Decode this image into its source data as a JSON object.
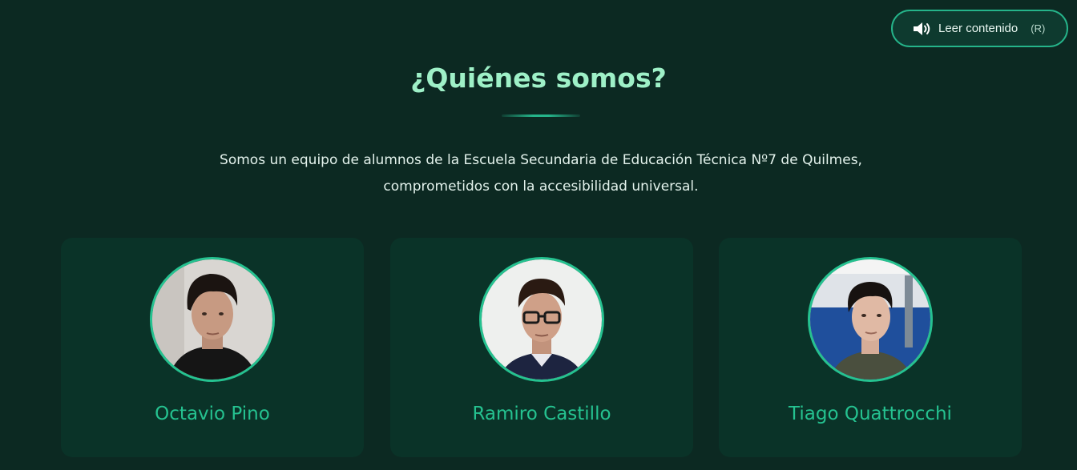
{
  "reader_button": {
    "label": "Leer contenido",
    "shortcut": "(R)",
    "icon": "speaker-icon"
  },
  "section": {
    "title": "¿Quiénes somos?",
    "intro": "Somos un equipo de alumnos de la Escuela Secundaria de Educación Técnica Nº7 de Quilmes, comprometidos con la accesibilidad universal."
  },
  "team": [
    {
      "name": "Octavio Pino"
    },
    {
      "name": "Ramiro Castillo"
    },
    {
      "name": "Tiago Quattrocchi"
    }
  ],
  "colors": {
    "background": "#0c2922",
    "card": "#0a3328",
    "accent": "#25c290",
    "title": "#9ef0c7"
  }
}
